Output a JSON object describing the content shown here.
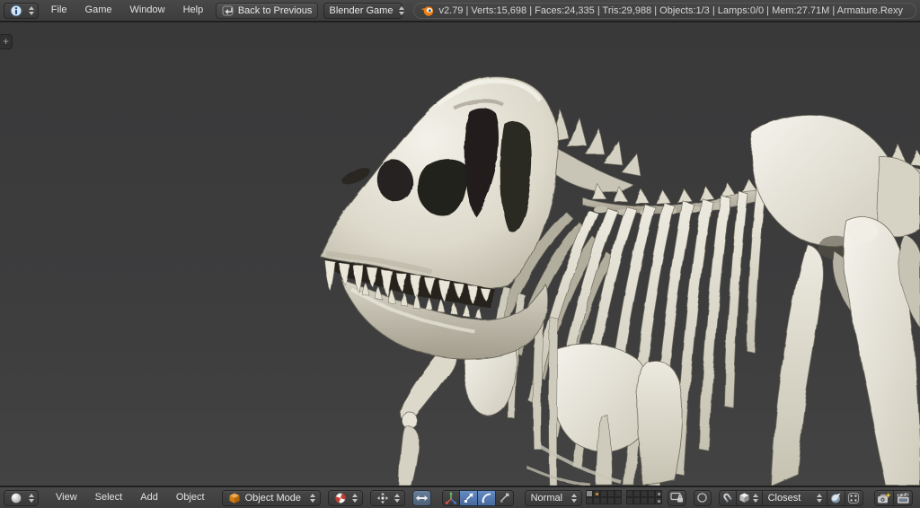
{
  "colors": {
    "header_bg": "#424242",
    "viewport_bg": "#3b3b3c",
    "accent_orange": "#ec8012",
    "pressed_blue": "#5579b7",
    "bone_light": "#ece9de",
    "bone_base": "#d4d0c2",
    "bone_shadow": "#8f8b7c",
    "layer_dot_orange": "#e0912d"
  },
  "top_bar": {
    "editor_selector": {
      "icon": "info-editor-icon"
    },
    "menus": [
      {
        "label": "File"
      },
      {
        "label": "Game"
      },
      {
        "label": "Window"
      },
      {
        "label": "Help"
      }
    ],
    "back_button": {
      "label": "Back to Previous",
      "icon": "back-arrow-icon"
    },
    "engine_select": {
      "value": "Blender Game"
    },
    "stats": {
      "text": "v2.79 | Verts:15,698 | Faces:24,335 | Tris:29,988 | Objects:1/3 | Lamps:0/0 | Mem:27.71M | Armature.Rexy"
    }
  },
  "viewport": {
    "toolshelf_expand_label": "+",
    "scene_object": "Armature.Rexy"
  },
  "bottom_bar": {
    "editor_selector": {
      "icon": "3d-view-icon"
    },
    "menus": [
      {
        "label": "View"
      },
      {
        "label": "Select"
      },
      {
        "label": "Add"
      },
      {
        "label": "Object"
      }
    ],
    "mode_select": {
      "value": "Object Mode"
    },
    "manipulator": {
      "centers_pressed": true,
      "translate_pressed": true,
      "rotate_pressed": true,
      "scale_pressed": false
    },
    "orientation_select": {
      "value": "Normal"
    },
    "layers": {
      "group1": [
        "active",
        "dot-orange",
        "off",
        "off",
        "off",
        "off",
        "off",
        "off",
        "off",
        "off"
      ],
      "group2": [
        "off",
        "off",
        "off",
        "off",
        "dot-grey",
        "off",
        "off",
        "off",
        "off",
        "dot-grey"
      ]
    },
    "snap_target_select": {
      "value": "Closest"
    }
  }
}
